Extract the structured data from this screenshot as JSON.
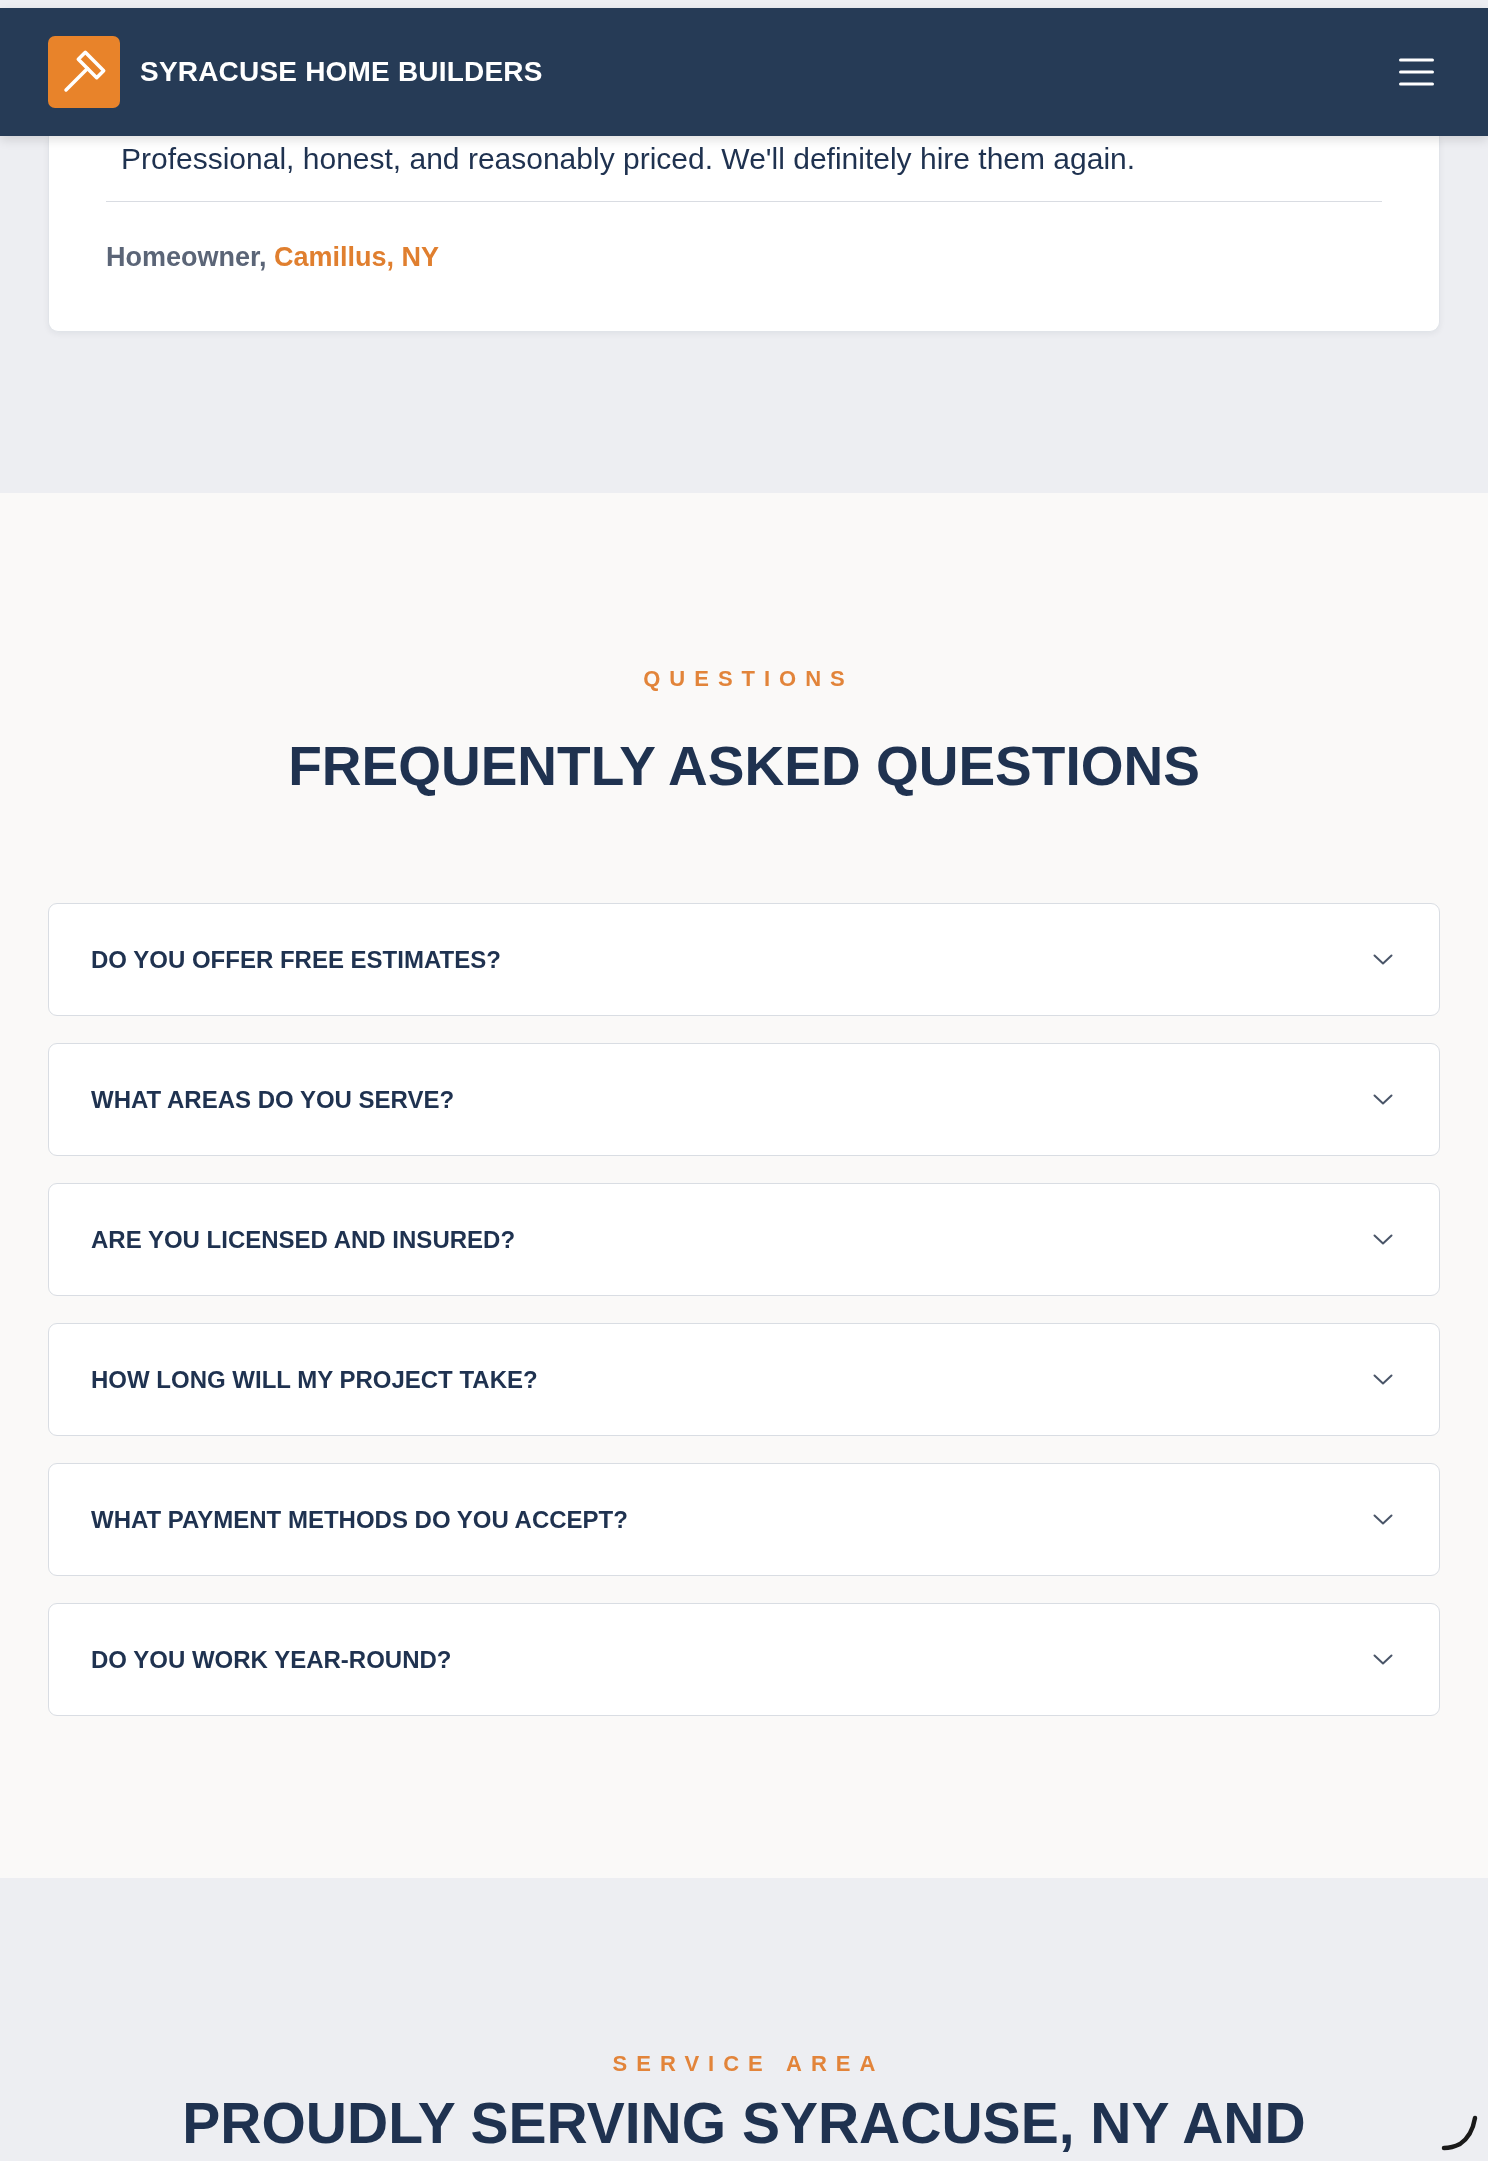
{
  "header": {
    "title": "SYRACUSE HOME BUILDERS"
  },
  "testimonial": {
    "quote": "Professional, honest, and reasonably priced. We'll definitely hire them again.",
    "author": "Homeowner,",
    "location": "Camillus, NY"
  },
  "faq": {
    "eyebrow": "QUESTIONS",
    "title": "FREQUENTLY ASKED QUESTIONS",
    "items": [
      {
        "question": "DO YOU OFFER FREE ESTIMATES?",
        "expanded": false
      },
      {
        "question": "WHAT AREAS DO YOU SERVE?",
        "expanded": false
      },
      {
        "question": "ARE YOU LICENSED AND INSURED?",
        "expanded": false
      },
      {
        "question": "HOW LONG WILL MY PROJECT TAKE?",
        "expanded": false
      },
      {
        "question": "WHAT PAYMENT METHODS DO YOU ACCEPT?",
        "expanded": false
      },
      {
        "question": "DO YOU WORK YEAR-ROUND?",
        "expanded": false
      }
    ]
  },
  "service_area": {
    "eyebrow": "SERVICE AREA",
    "title": "PROUDLY SERVING SYRACUSE, NY AND"
  }
}
